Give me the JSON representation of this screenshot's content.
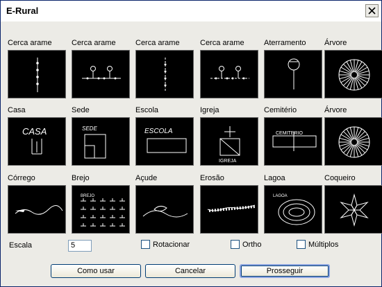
{
  "window": {
    "title": "E-Rural"
  },
  "items": [
    {
      "label": "Cerca arame",
      "icon": "fence-post-icon"
    },
    {
      "label": "Cerca arame",
      "icon": "fence-gate-icon"
    },
    {
      "label": "Cerca arame",
      "icon": "fence-dashed-icon"
    },
    {
      "label": "Cerca arame",
      "icon": "fence-gate-dashed-icon"
    },
    {
      "label": "Aterramento",
      "icon": "grounding-icon"
    },
    {
      "label": "Árvore",
      "icon": "tree-circle-icon"
    },
    {
      "label": "Casa",
      "icon": "house-icon",
      "text": "CASA"
    },
    {
      "label": "Sede",
      "icon": "headquarters-icon",
      "text": "SEDE"
    },
    {
      "label": "Escola",
      "icon": "school-icon",
      "text": "ESCOLA"
    },
    {
      "label": "Igreja",
      "icon": "church-icon",
      "text": "IGREJA"
    },
    {
      "label": "Cemitério",
      "icon": "cemetery-icon",
      "text": "CEMITERIO"
    },
    {
      "label": "Árvore",
      "icon": "tree-circle-icon"
    },
    {
      "label": "Córrego",
      "icon": "stream-icon"
    },
    {
      "label": "Brejo",
      "icon": "marsh-icon",
      "text": "BREJO"
    },
    {
      "label": "Açude",
      "icon": "dam-icon"
    },
    {
      "label": "Erosão",
      "icon": "erosion-icon"
    },
    {
      "label": "Lagoa",
      "icon": "lake-icon",
      "text": "LAGOA"
    },
    {
      "label": "Coqueiro",
      "icon": "palm-star-icon"
    }
  ],
  "scale": {
    "label": "Escala",
    "value": "5"
  },
  "options": [
    {
      "label": "Rotacionar",
      "checked": false
    },
    {
      "label": "Ortho",
      "checked": false
    },
    {
      "label": "Múltiplos",
      "checked": false
    }
  ],
  "buttons": {
    "help": "Como usar",
    "cancel": "Cancelar",
    "ok": "Prosseguir"
  }
}
